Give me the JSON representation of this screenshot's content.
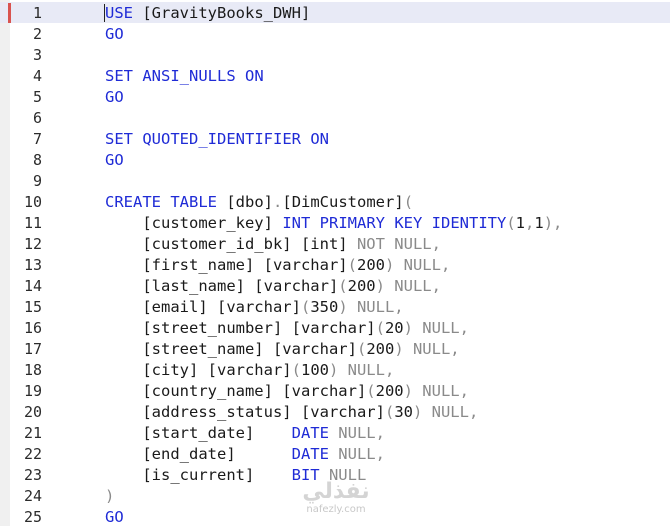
{
  "editor": {
    "lines": [
      {
        "number": "1",
        "tokens": [
          {
            "t": "USE",
            "c": "kw"
          },
          {
            "t": " [GravityBooks_DWH]",
            "c": "txt"
          }
        ]
      },
      {
        "number": "2",
        "tokens": [
          {
            "t": "GO",
            "c": "kw"
          }
        ]
      },
      {
        "number": "3",
        "tokens": []
      },
      {
        "number": "4",
        "tokens": [
          {
            "t": "SET",
            "c": "kw"
          },
          {
            "t": " ",
            "c": "txt"
          },
          {
            "t": "ANSI_NULLS",
            "c": "kw"
          },
          {
            "t": " ",
            "c": "txt"
          },
          {
            "t": "ON",
            "c": "kw"
          }
        ]
      },
      {
        "number": "5",
        "tokens": [
          {
            "t": "GO",
            "c": "kw"
          }
        ]
      },
      {
        "number": "6",
        "tokens": []
      },
      {
        "number": "7",
        "tokens": [
          {
            "t": "SET",
            "c": "kw"
          },
          {
            "t": " ",
            "c": "txt"
          },
          {
            "t": "QUOTED_IDENTIFIER",
            "c": "kw"
          },
          {
            "t": " ",
            "c": "txt"
          },
          {
            "t": "ON",
            "c": "kw"
          }
        ]
      },
      {
        "number": "8",
        "tokens": [
          {
            "t": "GO",
            "c": "kw"
          }
        ]
      },
      {
        "number": "9",
        "tokens": []
      },
      {
        "number": "10",
        "tokens": [
          {
            "t": "CREATE",
            "c": "kw"
          },
          {
            "t": " ",
            "c": "txt"
          },
          {
            "t": "TABLE",
            "c": "kw"
          },
          {
            "t": " [dbo]",
            "c": "txt"
          },
          {
            "t": ".",
            "c": "gray"
          },
          {
            "t": "[DimCustomer]",
            "c": "txt"
          },
          {
            "t": "(",
            "c": "gray"
          }
        ]
      },
      {
        "number": "11",
        "tokens": [
          {
            "t": "    [customer_key] ",
            "c": "txt"
          },
          {
            "t": "INT",
            "c": "kw"
          },
          {
            "t": " ",
            "c": "txt"
          },
          {
            "t": "PRIMARY",
            "c": "kw"
          },
          {
            "t": " ",
            "c": "txt"
          },
          {
            "t": "KEY",
            "c": "kw"
          },
          {
            "t": " ",
            "c": "txt"
          },
          {
            "t": "IDENTITY",
            "c": "kw"
          },
          {
            "t": "(",
            "c": "gray"
          },
          {
            "t": "1",
            "c": "txt"
          },
          {
            "t": ",",
            "c": "gray"
          },
          {
            "t": "1",
            "c": "txt"
          },
          {
            "t": "),",
            "c": "gray"
          }
        ]
      },
      {
        "number": "12",
        "tokens": [
          {
            "t": "    [customer_id_bk] [int] ",
            "c": "txt"
          },
          {
            "t": "NOT NULL,",
            "c": "gray"
          }
        ]
      },
      {
        "number": "13",
        "tokens": [
          {
            "t": "    [first_name] [varchar]",
            "c": "txt"
          },
          {
            "t": "(",
            "c": "gray"
          },
          {
            "t": "200",
            "c": "txt"
          },
          {
            "t": ") NULL,",
            "c": "gray"
          }
        ]
      },
      {
        "number": "14",
        "tokens": [
          {
            "t": "    [last_name] [varchar]",
            "c": "txt"
          },
          {
            "t": "(",
            "c": "gray"
          },
          {
            "t": "200",
            "c": "txt"
          },
          {
            "t": ") NULL,",
            "c": "gray"
          }
        ]
      },
      {
        "number": "15",
        "tokens": [
          {
            "t": "    [email] [varchar]",
            "c": "txt"
          },
          {
            "t": "(",
            "c": "gray"
          },
          {
            "t": "350",
            "c": "txt"
          },
          {
            "t": ") NULL,",
            "c": "gray"
          }
        ]
      },
      {
        "number": "16",
        "tokens": [
          {
            "t": "    [street_number] [varchar]",
            "c": "txt"
          },
          {
            "t": "(",
            "c": "gray"
          },
          {
            "t": "20",
            "c": "txt"
          },
          {
            "t": ") NULL,",
            "c": "gray"
          }
        ]
      },
      {
        "number": "17",
        "tokens": [
          {
            "t": "    [street_name] [varchar]",
            "c": "txt"
          },
          {
            "t": "(",
            "c": "gray"
          },
          {
            "t": "200",
            "c": "txt"
          },
          {
            "t": ") NULL,",
            "c": "gray"
          }
        ]
      },
      {
        "number": "18",
        "tokens": [
          {
            "t": "    [city] [varchar]",
            "c": "txt"
          },
          {
            "t": "(",
            "c": "gray"
          },
          {
            "t": "100",
            "c": "txt"
          },
          {
            "t": ") NULL,",
            "c": "gray"
          }
        ]
      },
      {
        "number": "19",
        "tokens": [
          {
            "t": "    [country_name] [varchar]",
            "c": "txt"
          },
          {
            "t": "(",
            "c": "gray"
          },
          {
            "t": "200",
            "c": "txt"
          },
          {
            "t": ") NULL,",
            "c": "gray"
          }
        ]
      },
      {
        "number": "20",
        "tokens": [
          {
            "t": "    [address_status] [varchar]",
            "c": "txt"
          },
          {
            "t": "(",
            "c": "gray"
          },
          {
            "t": "30",
            "c": "txt"
          },
          {
            "t": ") NULL,",
            "c": "gray"
          }
        ]
      },
      {
        "number": "21",
        "tokens": [
          {
            "t": "    [start_date]    ",
            "c": "txt"
          },
          {
            "t": "DATE",
            "c": "kw"
          },
          {
            "t": " NULL,",
            "c": "gray"
          }
        ]
      },
      {
        "number": "22",
        "tokens": [
          {
            "t": "    [end_date]      ",
            "c": "txt"
          },
          {
            "t": "DATE",
            "c": "kw"
          },
          {
            "t": " NULL,",
            "c": "gray"
          }
        ]
      },
      {
        "number": "23",
        "tokens": [
          {
            "t": "    [is_current]    ",
            "c": "txt"
          },
          {
            "t": "BIT",
            "c": "kw"
          },
          {
            "t": " NULL",
            "c": "gray"
          }
        ]
      },
      {
        "number": "24",
        "tokens": [
          {
            "t": ")",
            "c": "gray"
          }
        ]
      },
      {
        "number": "25",
        "tokens": [
          {
            "t": "GO",
            "c": "kw"
          }
        ]
      }
    ],
    "current_line": "1",
    "colors": {
      "keyword": "#1f2bd6",
      "text": "#1a1a1a",
      "punctuation": "#8a8a8a",
      "current_line_bg": "#e8eaf6",
      "marker": "#d9534f"
    }
  },
  "watermark": {
    "arabic": "نفذلي",
    "latin": "nafezly.com"
  }
}
